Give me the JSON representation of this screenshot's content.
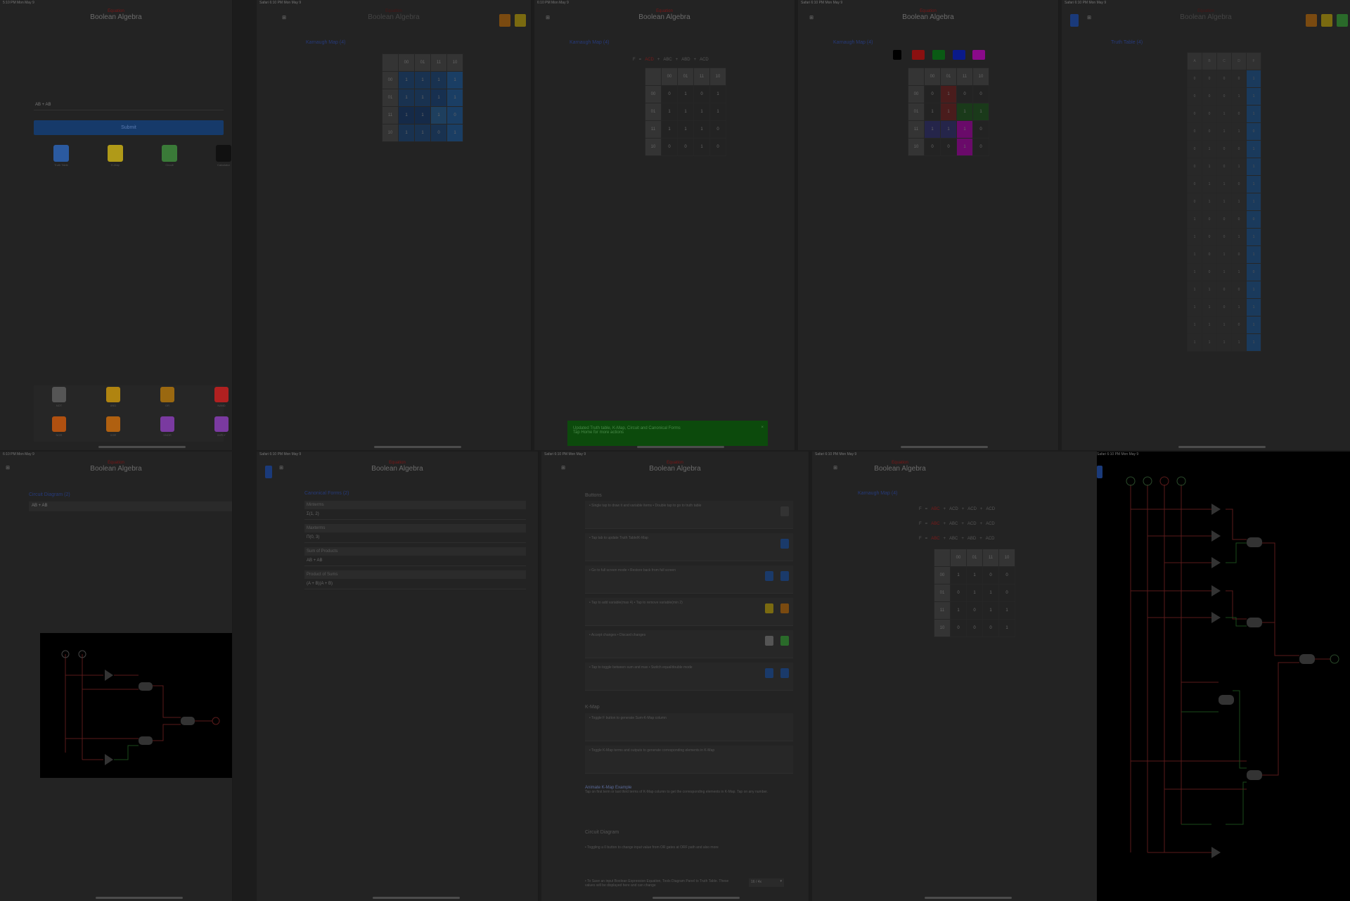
{
  "statusbar": {
    "p1": "5:10 PM  Mon May 9",
    "p2": "Safari  6:10 PM  Mon May 9",
    "p3": "6:10 PM  Mon May 9",
    "p4": "Safari  6:10 PM  Mon May 9",
    "p5": "Safari  6:10 PM  Mon May 9",
    "p6": "6:10 PM  Mon May 9",
    "p7": "Safari  6:10 PM  Mon May 9",
    "p8": "Safari  6:10 PM  Mon May 9",
    "p9": "Safari  6:10 PM  Mon May 9",
    "p10": "Safari  6:10 PM  Mon May 9"
  },
  "app": {
    "subtitle": "Equation",
    "title": "Boolean Algebra"
  },
  "home": {
    "expression": "AB + AB",
    "submit_label": "Submit",
    "tools": [
      {
        "label": "Truth Table",
        "color": "#2b5aa0"
      },
      {
        "label": "K-Map",
        "color": "#b09a18"
      },
      {
        "label": "Circuit",
        "color": "#3a7a38"
      },
      {
        "label": "Calculator",
        "color": "#111111"
      }
    ],
    "gates": [
      {
        "label": "NOT",
        "color": "#555555"
      },
      {
        "label": "AND",
        "color": "#b08410"
      },
      {
        "label": "OR",
        "color": "#9a6810"
      },
      {
        "label": "NAND",
        "color": "#b02020"
      },
      {
        "label": "NOR",
        "color": "#b05010"
      },
      {
        "label": "XOR",
        "color": "#b06010"
      },
      {
        "label": "XNOR",
        "color": "#7a3aa0"
      },
      {
        "label": "IMPLY",
        "color": "#7a3aa0"
      }
    ]
  },
  "kmap1": {
    "title": "Karnaugh Map (4)"
  },
  "kmap2": {
    "title": "Karnaugh Map (4)",
    "chips": [
      "F",
      "=",
      "ACD",
      "+",
      "ABC",
      "+",
      "ABD",
      "+",
      "ACD"
    ]
  },
  "kmap3": {
    "title": "Karnaugh Map (4)"
  },
  "truth": {
    "title": "Truth Table (4)",
    "headers": [
      "A",
      "B",
      "C",
      "D",
      "F"
    ]
  },
  "toast": {
    "line1": "Updated Truth table, K-Map, Circuit and Canonical Forms",
    "line2": "Tap Home for more actions"
  },
  "circuit_small": {
    "title": "Circuit Diagram (2)",
    "expression": "AB + AB",
    "inputs": [
      "A",
      "B"
    ],
    "gates": [
      "NOT",
      "AND",
      "NOT",
      "AND",
      "OR"
    ],
    "output": "F"
  },
  "canon": {
    "title": "Canonical Forms (2)",
    "items": [
      {
        "label": "Minterms",
        "value": "Σ(1, 2)"
      },
      {
        "label": "Maxterms",
        "value": "Π(0, 3)"
      },
      {
        "label": "Sum of Products",
        "value": "AB + AB"
      },
      {
        "label": "Product of Sums",
        "value": "(A + B)(A + B)"
      }
    ]
  },
  "help": {
    "section_buttons": "Buttons",
    "section_kmap": "K-Map",
    "section_circuit": "Circuit Diagram",
    "rows": [
      "• Single tap to draw it and variable items  • Double tap to go to truth table",
      "• Tap tab to update Truth Table/K-Map",
      "• Go to full screen mode  • Restore back from full screen",
      "• Tap to add variable(max 4)  • Tap to remove variable(min 2)",
      "• Accept changes  • Discard changes",
      "• Tap to toggle between sum and max  • Switch equal/double mode"
    ],
    "kmap_rows": [
      "• Toggle F button to generate Sum-K-Map column",
      "• Toggle K-Map terms and outputs to generate corresponding elements in K-Map"
    ],
    "example_title": "Animate K-Map Example",
    "example_text": "Tap on first term or last third terms of K-Map column to get the corresponding elements in K-Map. Tap on any number.",
    "circuit_rows": [
      "• Toggling a 0 button to change input value from OR gates at ORF path and also more",
      "• To Save an input Boolean Expression Equation, Tools Diagram Panel to Truth Table. These values will be displayed here and can change"
    ],
    "select_value": "16 / 4x"
  },
  "kmap4": {
    "title": "Karnaugh Map (4)",
    "rows": [
      [
        "F",
        "=",
        "ABC",
        "+",
        "ACD",
        "+",
        "ACD",
        "+",
        "ACD"
      ],
      [
        "F",
        "=",
        "ABC",
        "+",
        "ABC",
        "+",
        "ACD",
        "+",
        "ACD"
      ],
      [
        "F",
        "=",
        "ABC",
        "+",
        "ABC",
        "+",
        "ABD",
        "+",
        "ACD"
      ]
    ]
  },
  "circuit_full": {
    "inputs": [
      "A",
      "B",
      "C",
      "D"
    ],
    "gates": [
      "AND",
      "AND",
      "OR",
      "AND",
      "AND"
    ],
    "output": "F"
  }
}
